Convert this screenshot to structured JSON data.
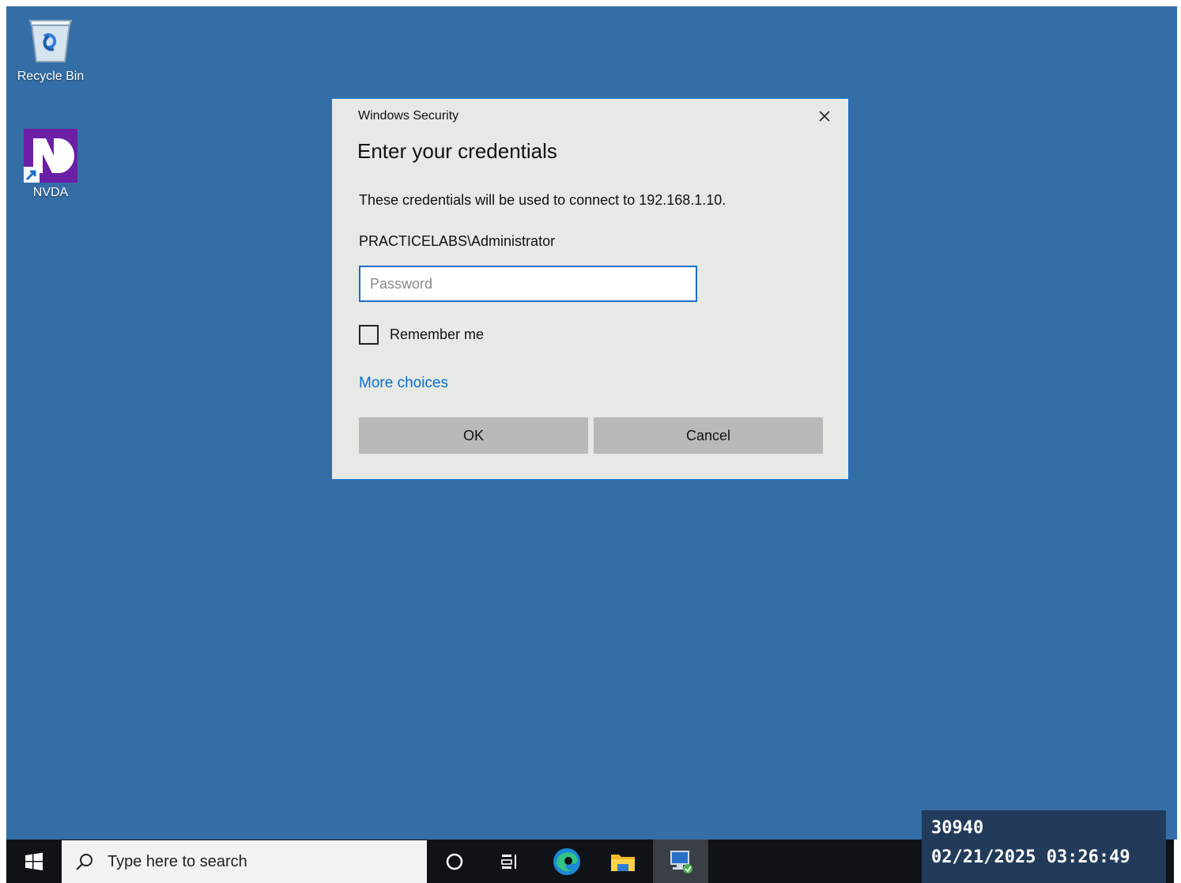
{
  "desktop": {
    "background_color": "#346ea6",
    "icons": [
      {
        "label": "Recycle Bin",
        "icon": "recycle-bin-icon"
      },
      {
        "label": "NVDA",
        "icon": "nvda-icon"
      }
    ]
  },
  "dialog": {
    "title": "Windows Security",
    "heading": "Enter your credentials",
    "description": "These credentials will be used to connect to 192.168.1.10.",
    "username": "PRACTICELABS\\Administrator",
    "password": {
      "placeholder": "Password",
      "value": ""
    },
    "remember_me": {
      "label": "Remember me",
      "checked": false
    },
    "more_choices": "More choices",
    "ok_label": "OK",
    "cancel_label": "Cancel",
    "accent_color": "#1a78d6"
  },
  "taskbar": {
    "search_placeholder": "Type here to search",
    "items": [
      "windows-start-icon",
      "cortana-circle-icon",
      "task-view-icon",
      "edge-icon",
      "file-explorer-icon",
      "remote-desktop-icon"
    ]
  },
  "overlay": {
    "counter": "30940",
    "datetime": "02/21/2025 03:26:49"
  }
}
